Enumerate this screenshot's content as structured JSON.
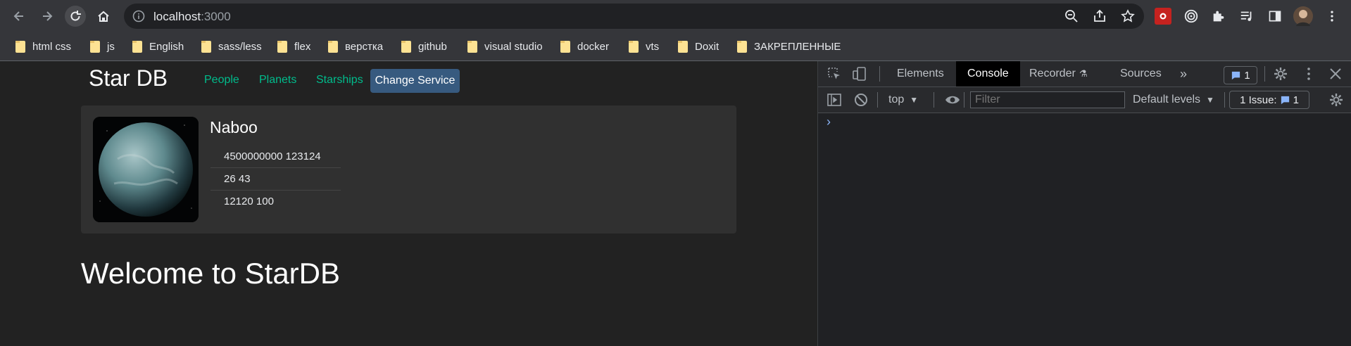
{
  "browser": {
    "url_host": "localhost",
    "url_port": ":3000",
    "icons": [
      "back-icon",
      "forward-icon",
      "reload-icon",
      "home-icon",
      "info-icon",
      "zoom-icon",
      "share-icon",
      "star-icon"
    ],
    "bookmarks": [
      "html css",
      "js",
      "English",
      "sass/less",
      "flex",
      "верстка",
      "github",
      "visual studio",
      "docker",
      "vts",
      "Doxit",
      "ЗАКРЕПЛЕННЫЕ"
    ]
  },
  "app": {
    "brand": "Star DB",
    "nav": [
      "People",
      "Planets",
      "Starships"
    ],
    "change_service": "Change Service",
    "planet": {
      "name": "Naboo",
      "details": [
        "4500000000  123124",
        "26  43",
        "12120  100"
      ]
    },
    "welcome": "Welcome to StarDB"
  },
  "devtools": {
    "tabs": [
      "Elements",
      "Console",
      "Recorder",
      "Sources"
    ],
    "active_tab": "Console",
    "issue_count": "1",
    "context": "top",
    "filter_placeholder": "Filter",
    "levels": "Default levels",
    "issues_label": "1 Issue:",
    "issues_count": "1",
    "prompt": "›"
  },
  "colors": {
    "accent_green": "#00bc8c",
    "button_blue": "#375a7f",
    "devtools_blue": "#8ab4f8"
  }
}
